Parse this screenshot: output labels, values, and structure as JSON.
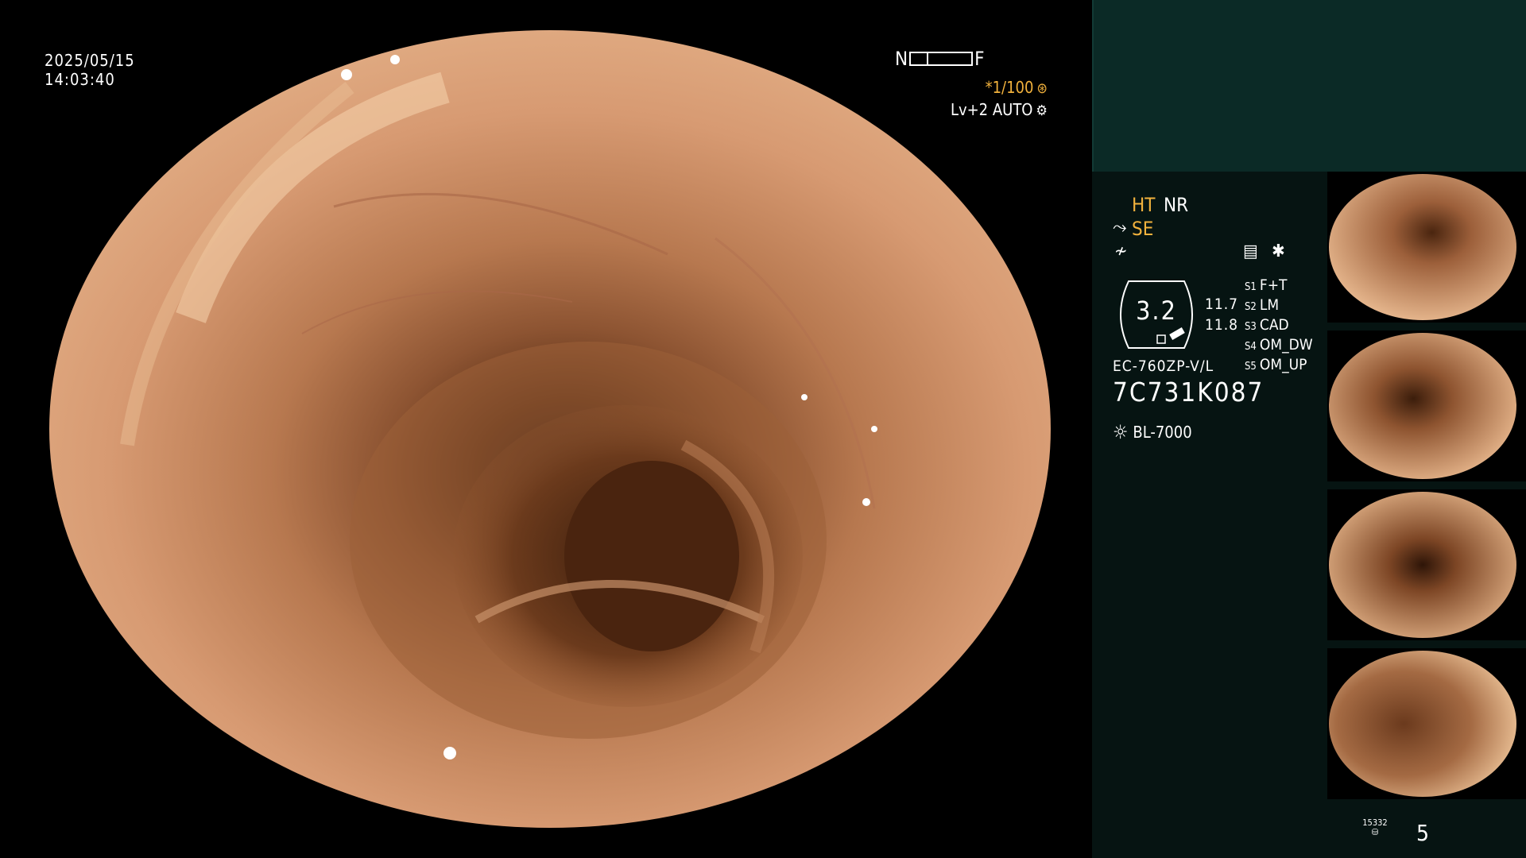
{
  "overlay": {
    "date": "2025/05/15",
    "time": "14:03:40",
    "near_label": "N",
    "far_label": "F",
    "shutter": "*1/100",
    "level": "Lv+2",
    "mode": "AUTO"
  },
  "panel": {
    "flags": {
      "ht": "HT",
      "nr": "NR",
      "se": "SE"
    },
    "dial_value": "3.2",
    "dial_nums": [
      "11.7",
      "11.8"
    ],
    "modes": [
      {
        "key": "S1",
        "label": "F+T"
      },
      {
        "key": "S2",
        "label": "LM"
      },
      {
        "key": "S3",
        "label": "CAD"
      },
      {
        "key": "S4",
        "label": "OM_DW"
      },
      {
        "key": "S5",
        "label": "OM_UP"
      }
    ],
    "scope_model": "EC-760ZP-V/L",
    "scope_serial": "7C731K087",
    "light_source": "BL-7000",
    "image_count": "5",
    "counter": "15332"
  },
  "colors": {
    "accent": "#f2b23d",
    "panel_bg": "#061412",
    "panel_top": "#0b2a26"
  },
  "icons": [
    "sun-icon",
    "gear-icon",
    "aperture-icon",
    "enhance-icon",
    "asterisk-icon",
    "mucosa-icon"
  ]
}
